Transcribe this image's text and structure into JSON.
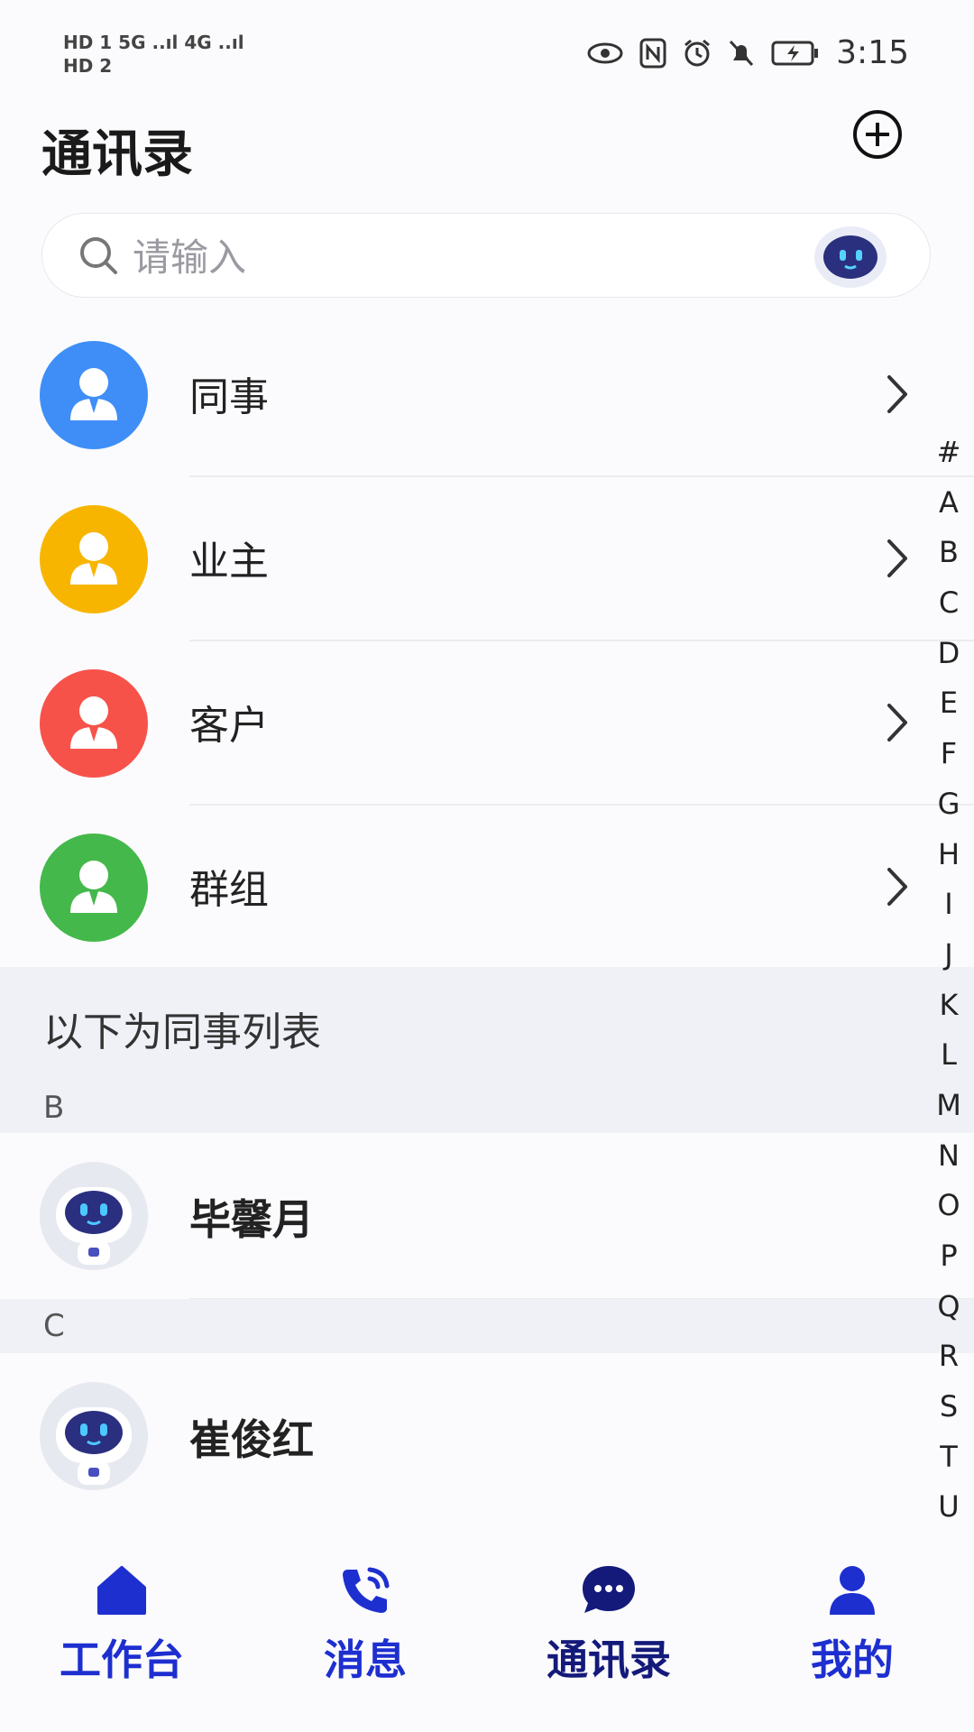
{
  "status_bar": {
    "left_line1": "HD 1  5G ..ıl  4G ..ıl",
    "left_line2": "HD 2",
    "time": "3:15"
  },
  "header": {
    "title": "通讯录",
    "add_icon": "plus-circle-icon"
  },
  "search": {
    "placeholder": "请输入",
    "icon": "search-icon",
    "assistant_icon": "robot-assistant-icon"
  },
  "categories": [
    {
      "label": "同事",
      "color": "#3f8ef7"
    },
    {
      "label": "业主",
      "color": "#f7b500"
    },
    {
      "label": "客户",
      "color": "#f7524a"
    },
    {
      "label": "群组",
      "color": "#44b84b"
    }
  ],
  "section": {
    "title": "以下为同事列表"
  },
  "groups": [
    {
      "letter": "B",
      "contacts": [
        {
          "name": "毕馨月"
        }
      ]
    },
    {
      "letter": "C",
      "contacts": [
        {
          "name": "崔俊红"
        }
      ]
    }
  ],
  "alphabet_index": [
    "#",
    "A",
    "B",
    "C",
    "D",
    "E",
    "F",
    "G",
    "H",
    "I",
    "J",
    "K",
    "L",
    "M",
    "N",
    "O",
    "P",
    "Q",
    "R",
    "S",
    "T",
    "U"
  ],
  "bottom_nav": [
    {
      "label": "工作台",
      "icon": "home-icon",
      "color": "#1e2fd0"
    },
    {
      "label": "消息",
      "icon": "phone-call-icon",
      "color": "#1e2fd0"
    },
    {
      "label": "通讯录",
      "icon": "chat-bubble-icon",
      "color": "#141a7a"
    },
    {
      "label": "我的",
      "icon": "user-icon",
      "color": "#1e2fd0"
    }
  ]
}
